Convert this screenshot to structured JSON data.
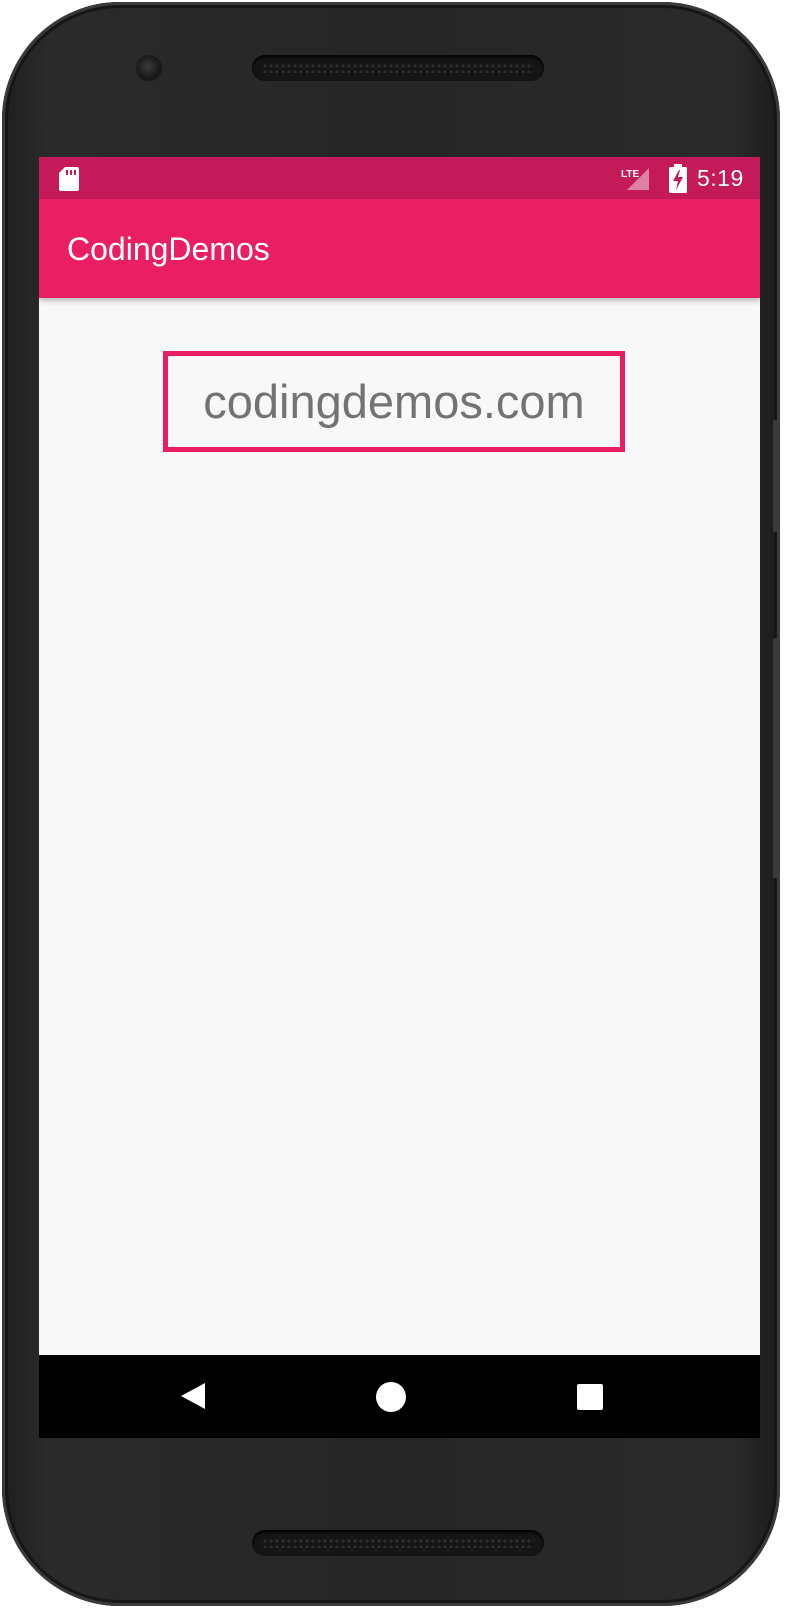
{
  "status_bar": {
    "network_label": "LTE",
    "time": "5:19"
  },
  "app_bar": {
    "title": "CodingDemos"
  },
  "content": {
    "link_text": "codingdemos.com"
  },
  "colors": {
    "primary": "#e91e63",
    "primary_dark": "#c41a59",
    "background": "#f8f8f8",
    "text_gray": "#737373"
  },
  "icons": {
    "status_left": "sd-card-icon",
    "status_signal": "lte-signal-icon",
    "status_battery": "battery-charging-icon",
    "nav_back": "back-triangle-icon",
    "nav_home": "home-circle-icon",
    "nav_recent": "recents-square-icon"
  }
}
